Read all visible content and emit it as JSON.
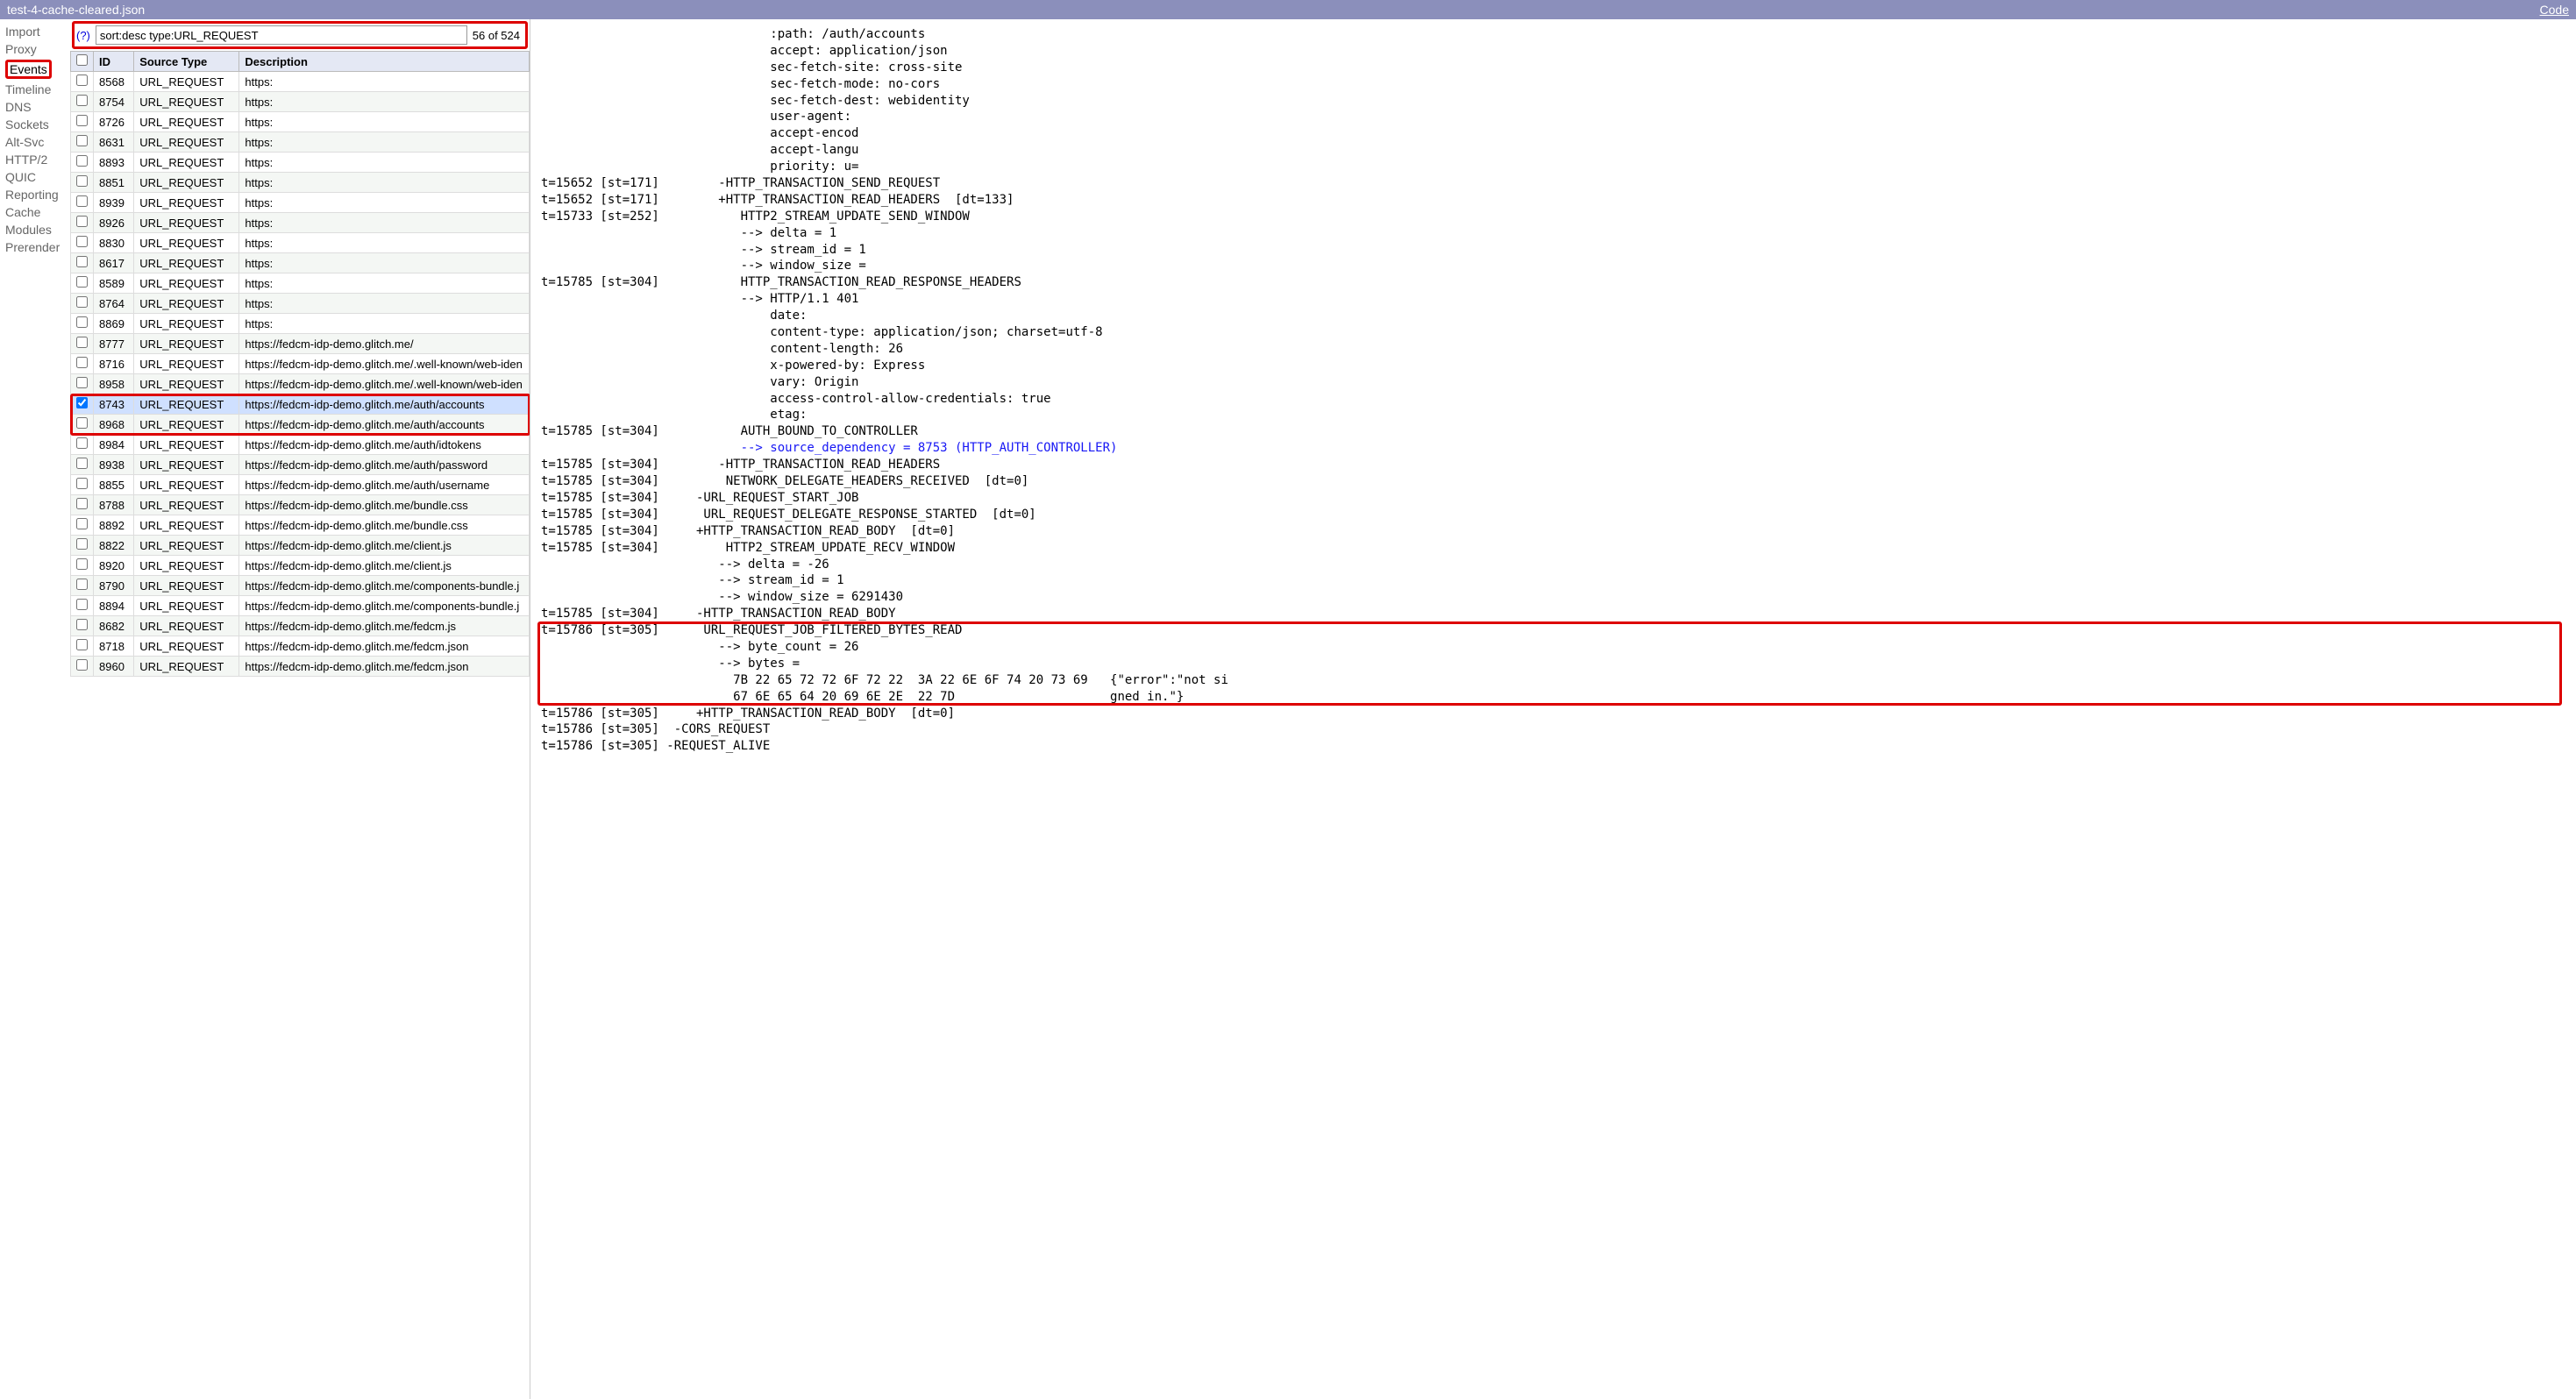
{
  "titlebar": {
    "filename": "test-4-cache-cleared.json",
    "code_link": "Code"
  },
  "sidebar": {
    "items": [
      {
        "label": "Import",
        "active": false
      },
      {
        "label": "Proxy",
        "active": false
      },
      {
        "label": "Events",
        "active": true,
        "boxed": true
      },
      {
        "label": "Timeline",
        "active": false
      },
      {
        "label": "DNS",
        "active": false
      },
      {
        "label": "Sockets",
        "active": false
      },
      {
        "label": "Alt-Svc",
        "active": false
      },
      {
        "label": "HTTP/2",
        "active": false
      },
      {
        "label": "QUIC",
        "active": false
      },
      {
        "label": "Reporting",
        "active": false
      },
      {
        "label": "Cache",
        "active": false
      },
      {
        "label": "Modules",
        "active": false
      },
      {
        "label": "Prerender",
        "active": false
      }
    ]
  },
  "search": {
    "help_label": "(?)",
    "query": "sort:desc type:URL_REQUEST",
    "count_label": "56 of 524"
  },
  "table": {
    "headers": {
      "checkbox": "",
      "id": "ID",
      "type": "Source Type",
      "desc": "Description"
    },
    "rows": [
      {
        "id": "8568",
        "type": "URL_REQUEST",
        "desc": "https:"
      },
      {
        "id": "8754",
        "type": "URL_REQUEST",
        "desc": "https:"
      },
      {
        "id": "8726",
        "type": "URL_REQUEST",
        "desc": "https:"
      },
      {
        "id": "8631",
        "type": "URL_REQUEST",
        "desc": "https:"
      },
      {
        "id": "8893",
        "type": "URL_REQUEST",
        "desc": "https:"
      },
      {
        "id": "8851",
        "type": "URL_REQUEST",
        "desc": "https:"
      },
      {
        "id": "8939",
        "type": "URL_REQUEST",
        "desc": "https:"
      },
      {
        "id": "8926",
        "type": "URL_REQUEST",
        "desc": "https:"
      },
      {
        "id": "8830",
        "type": "URL_REQUEST",
        "desc": "https:"
      },
      {
        "id": "8617",
        "type": "URL_REQUEST",
        "desc": "https:"
      },
      {
        "id": "8589",
        "type": "URL_REQUEST",
        "desc": "https:"
      },
      {
        "id": "8764",
        "type": "URL_REQUEST",
        "desc": "https:"
      },
      {
        "id": "8869",
        "type": "URL_REQUEST",
        "desc": "https:"
      },
      {
        "id": "8777",
        "type": "URL_REQUEST",
        "desc": "https://fedcm-idp-demo.glitch.me/"
      },
      {
        "id": "8716",
        "type": "URL_REQUEST",
        "desc": "https://fedcm-idp-demo.glitch.me/.well-known/web-iden"
      },
      {
        "id": "8958",
        "type": "URL_REQUEST",
        "desc": "https://fedcm-idp-demo.glitch.me/.well-known/web-iden"
      },
      {
        "id": "8743",
        "type": "URL_REQUEST",
        "desc": "https://fedcm-idp-demo.glitch.me/auth/accounts",
        "checked": true,
        "selected": true,
        "redbox": "start"
      },
      {
        "id": "8968",
        "type": "URL_REQUEST",
        "desc": "https://fedcm-idp-demo.glitch.me/auth/accounts",
        "redbox": "end"
      },
      {
        "id": "8984",
        "type": "URL_REQUEST",
        "desc": "https://fedcm-idp-demo.glitch.me/auth/idtokens"
      },
      {
        "id": "8938",
        "type": "URL_REQUEST",
        "desc": "https://fedcm-idp-demo.glitch.me/auth/password"
      },
      {
        "id": "8855",
        "type": "URL_REQUEST",
        "desc": "https://fedcm-idp-demo.glitch.me/auth/username"
      },
      {
        "id": "8788",
        "type": "URL_REQUEST",
        "desc": "https://fedcm-idp-demo.glitch.me/bundle.css"
      },
      {
        "id": "8892",
        "type": "URL_REQUEST",
        "desc": "https://fedcm-idp-demo.glitch.me/bundle.css"
      },
      {
        "id": "8822",
        "type": "URL_REQUEST",
        "desc": "https://fedcm-idp-demo.glitch.me/client.js"
      },
      {
        "id": "8920",
        "type": "URL_REQUEST",
        "desc": "https://fedcm-idp-demo.glitch.me/client.js"
      },
      {
        "id": "8790",
        "type": "URL_REQUEST",
        "desc": "https://fedcm-idp-demo.glitch.me/components-bundle.j"
      },
      {
        "id": "8894",
        "type": "URL_REQUEST",
        "desc": "https://fedcm-idp-demo.glitch.me/components-bundle.j"
      },
      {
        "id": "8682",
        "type": "URL_REQUEST",
        "desc": "https://fedcm-idp-demo.glitch.me/fedcm.js"
      },
      {
        "id": "8718",
        "type": "URL_REQUEST",
        "desc": "https://fedcm-idp-demo.glitch.me/fedcm.json"
      },
      {
        "id": "8960",
        "type": "URL_REQUEST",
        "desc": "https://fedcm-idp-demo.glitch.me/fedcm.json"
      }
    ]
  },
  "details": {
    "lines": [
      "                               :path: /auth/accounts",
      "                               accept: application/json",
      "                               sec-fetch-site: cross-site",
      "                               sec-fetch-mode: no-cors",
      "                               sec-fetch-dest: webidentity",
      "                               user-agent:",
      "                               accept-encod",
      "                               accept-langu",
      "                               priority: u=",
      "t=15652 [st=171]        -HTTP_TRANSACTION_SEND_REQUEST",
      "t=15652 [st=171]        +HTTP_TRANSACTION_READ_HEADERS  [dt=133]",
      "t=15733 [st=252]           HTTP2_STREAM_UPDATE_SEND_WINDOW",
      "                           --> delta = 1",
      "                           --> stream_id = 1",
      "                           --> window_size =",
      "t=15785 [st=304]           HTTP_TRANSACTION_READ_RESPONSE_HEADERS",
      "                           --> HTTP/1.1 401",
      "                               date:",
      "                               content-type: application/json; charset=utf-8",
      "                               content-length: 26",
      "                               x-powered-by: Express",
      "                               vary: Origin",
      "                               access-control-allow-credentials: true",
      "                               etag:",
      "t=15785 [st=304]           AUTH_BOUND_TO_CONTROLLER",
      {
        "blue": true,
        "text": "                           --> source_dependency = 8753 (HTTP_AUTH_CONTROLLER)"
      },
      "t=15785 [st=304]        -HTTP_TRANSACTION_READ_HEADERS",
      "t=15785 [st=304]         NETWORK_DELEGATE_HEADERS_RECEIVED  [dt=0]",
      "t=15785 [st=304]     -URL_REQUEST_START_JOB",
      "t=15785 [st=304]      URL_REQUEST_DELEGATE_RESPONSE_STARTED  [dt=0]",
      "t=15785 [st=304]     +HTTP_TRANSACTION_READ_BODY  [dt=0]",
      "t=15785 [st=304]         HTTP2_STREAM_UPDATE_RECV_WINDOW",
      "                        --> delta = -26",
      "                        --> stream_id = 1",
      "                        --> window_size = 6291430",
      "t=15785 [st=304]     -HTTP_TRANSACTION_READ_BODY",
      {
        "box": "start",
        "text": "t=15786 [st=305]      URL_REQUEST_JOB_FILTERED_BYTES_READ"
      },
      "                        --> byte_count = 26",
      "                        --> bytes =",
      "                          7B 22 65 72 72 6F 72 22  3A 22 6E 6F 74 20 73 69   {\"error\":\"not si",
      {
        "box": "end",
        "text": "                          67 6E 65 64 20 69 6E 2E  22 7D                     gned in.\"}"
      },
      "t=15786 [st=305]     +HTTP_TRANSACTION_READ_BODY  [dt=0]",
      "t=15786 [st=305]  -CORS_REQUEST",
      "t=15786 [st=305] -REQUEST_ALIVE"
    ]
  }
}
